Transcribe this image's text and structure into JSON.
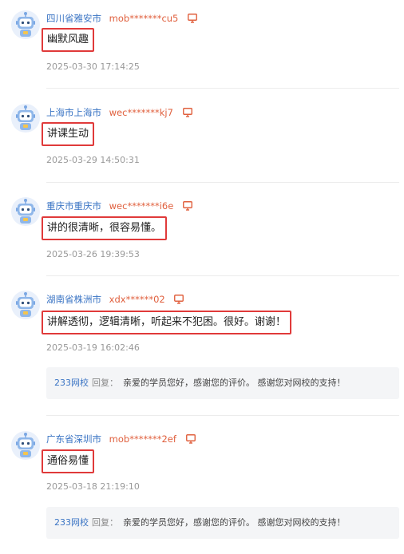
{
  "comments": [
    {
      "location": "四川省雅安市",
      "user": "mob*******cu5",
      "content": "幽默风趣",
      "date": "2025-03-30 17:14:25"
    },
    {
      "location": "上海市上海市",
      "user": "wec*******kj7",
      "content": "讲课生动",
      "date": "2025-03-29 14:50:31"
    },
    {
      "location": "重庆市重庆市",
      "user": "wec*******i6e",
      "content": "讲的很清晰，很容易懂。",
      "date": "2025-03-26 19:39:53"
    },
    {
      "location": "湖南省株洲市",
      "user": "xdx******02",
      "content": "讲解透彻，逻辑清晰，听起来不犯困。很好。谢谢！",
      "date": "2025-03-19 16:02:46",
      "reply": {
        "school": "233网校",
        "label": "回复：",
        "text": "亲爱的学员您好，感谢您的评价。 感谢您对网校的支持！"
      }
    },
    {
      "location": "广东省深圳市",
      "user": "mob*******2ef",
      "content": "通俗易懂",
      "date": "2025-03-18 21:19:10",
      "reply": {
        "school": "233网校",
        "label": "回复：",
        "text": "亲爱的学员您好，感谢您的评价。 感谢您对网校的支持！"
      }
    }
  ],
  "icons": {
    "avatar": "robot-avatar-icon",
    "device": "computer-monitor-icon"
  },
  "colors": {
    "location": "#3a74c4",
    "user": "#e0603e",
    "highlight_border": "#e03a3a",
    "reply_bg": "#f4f5f7"
  }
}
